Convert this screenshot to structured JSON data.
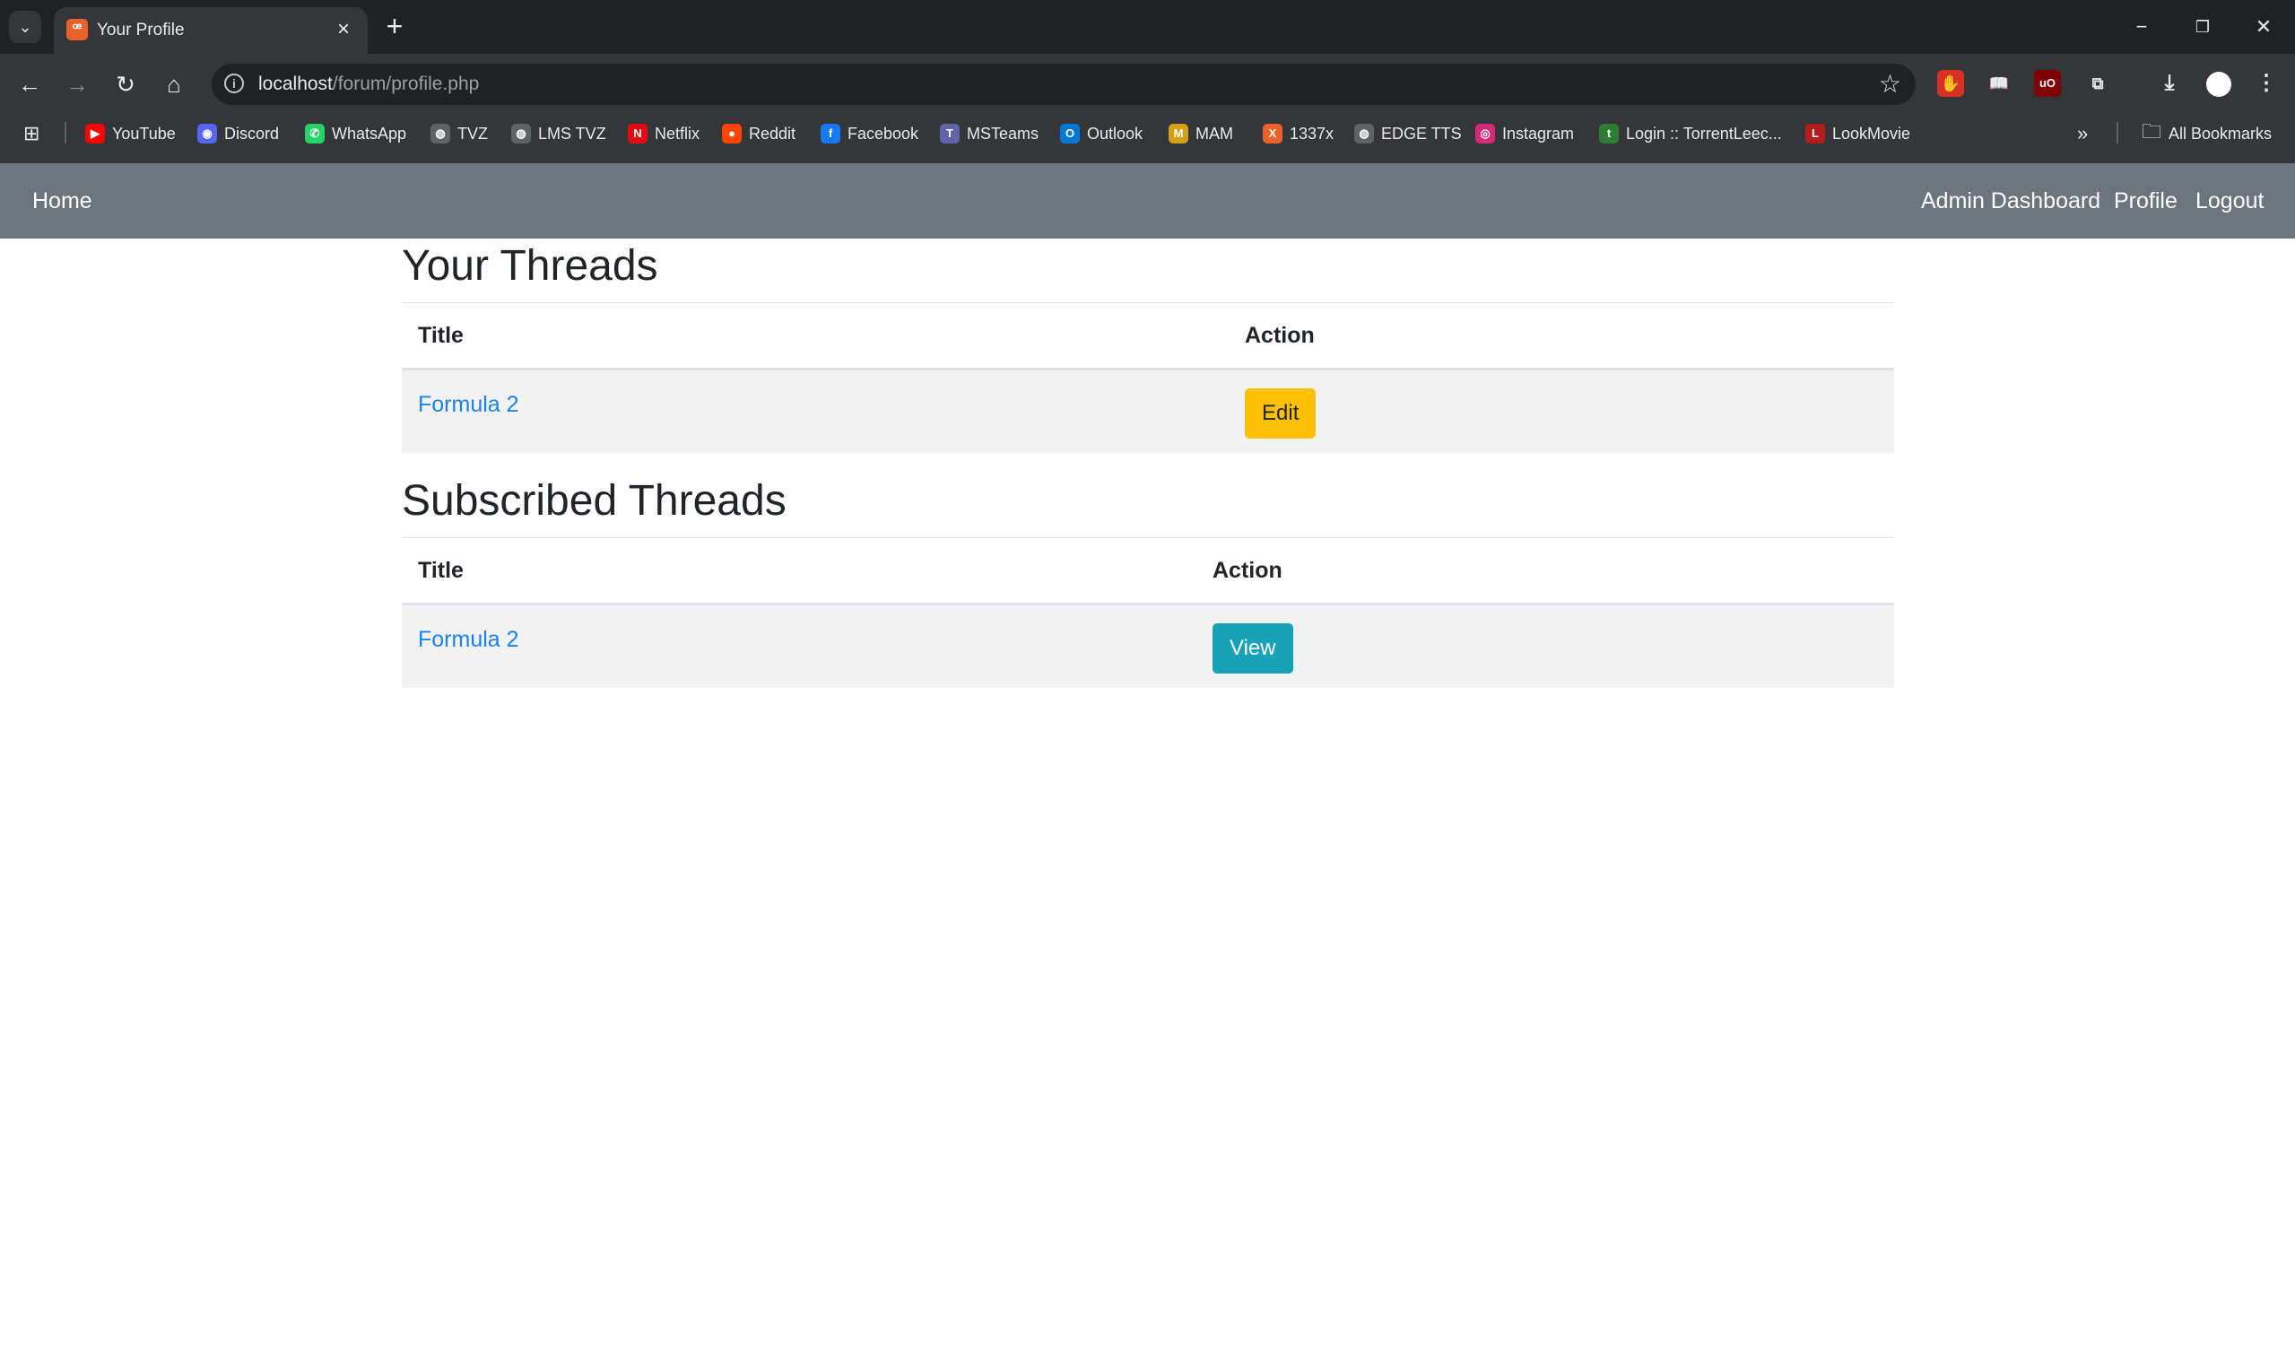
{
  "browser": {
    "tab_title": "Your Profile",
    "url_host": "localhost",
    "url_path": "/forum/profile.php",
    "bookmarks": [
      {
        "label": "YouTube",
        "icon": "youtube-icon",
        "color": "#ff0000",
        "glyph": "▶"
      },
      {
        "label": "Discord",
        "icon": "discord-icon",
        "color": "#5865f2",
        "glyph": "◉"
      },
      {
        "label": "WhatsApp",
        "icon": "whatsapp-icon",
        "color": "#25d366",
        "glyph": "✆"
      },
      {
        "label": "TVZ",
        "icon": "globe-icon",
        "color": "#5f6368",
        "glyph": "◍"
      },
      {
        "label": "LMS TVZ",
        "icon": "globe-icon",
        "color": "#5f6368",
        "glyph": "◍"
      },
      {
        "label": "Netflix",
        "icon": "netflix-icon",
        "color": "#e50914",
        "glyph": "N"
      },
      {
        "label": "Reddit",
        "icon": "reddit-icon",
        "color": "#ff4500",
        "glyph": "●"
      },
      {
        "label": "Facebook",
        "icon": "facebook-icon",
        "color": "#1877f2",
        "glyph": "f"
      },
      {
        "label": "MSTeams",
        "icon": "teams-icon",
        "color": "#6264a7",
        "glyph": "T"
      },
      {
        "label": "Outlook",
        "icon": "outlook-icon",
        "color": "#0078d4",
        "glyph": "O"
      },
      {
        "label": "MAM",
        "icon": "mam-icon",
        "color": "#d4a017",
        "glyph": "M"
      },
      {
        "label": "1337x",
        "icon": "x-icon",
        "color": "#e8622a",
        "glyph": "X"
      },
      {
        "label": "EDGE TTS",
        "icon": "globe-icon",
        "color": "#5f6368",
        "glyph": "◍"
      },
      {
        "label": "Instagram",
        "icon": "instagram-icon",
        "color": "#d62976",
        "glyph": "◎"
      },
      {
        "label": "Login :: TorrentLeec...",
        "icon": "torrentleech-icon",
        "color": "#2e7d32",
        "glyph": "t"
      },
      {
        "label": "LookMovie",
        "icon": "lookmovie-icon",
        "color": "#b71c1c",
        "glyph": "L"
      }
    ],
    "all_bookmarks": "All Bookmarks"
  },
  "navbar": {
    "home": "Home",
    "admin": "Admin Dashboard",
    "profile": "Profile",
    "logout": "Logout"
  },
  "your_threads": {
    "heading": "Your Threads",
    "col_title": "Title",
    "col_action": "Action",
    "rows": [
      {
        "title": "Formula 2",
        "action": "Edit"
      }
    ]
  },
  "subscribed_threads": {
    "heading": "Subscribed Threads",
    "col_title": "Title",
    "col_action": "Action",
    "rows": [
      {
        "title": "Formula 2",
        "action": "View"
      }
    ]
  }
}
